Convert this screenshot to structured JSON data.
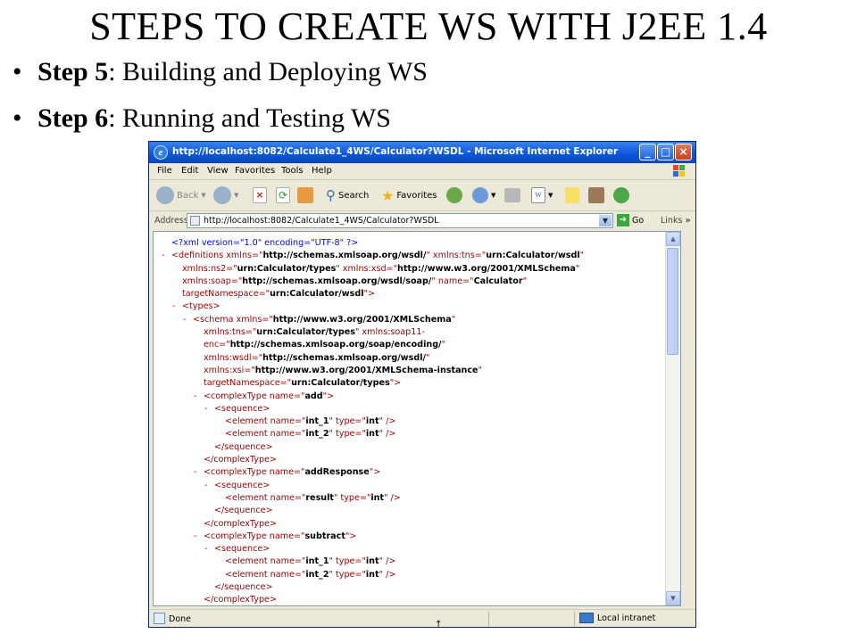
{
  "slide": {
    "title": "STEPS TO CREATE WS WITH J2EE 1.4",
    "bullets": [
      {
        "bold": "Step 5",
        "rest": ": Building and Deploying WS"
      },
      {
        "bold": "Step 6",
        "rest": ": Running and Testing WS"
      }
    ]
  },
  "browser": {
    "window_title": "http://localhost:8082/Calculate1_4WS/Calculator?WSDL - Microsoft Internet Explorer",
    "menu": [
      "File",
      "Edit",
      "View",
      "Favorites",
      "Tools",
      "Help"
    ],
    "toolbar": {
      "back": "Back",
      "search": "Search",
      "favorites": "Favorites"
    },
    "address": {
      "label": "Address",
      "url": "http://localhost:8082/Calculate1_4WS/Calculator?WSDL",
      "go": "Go",
      "links": "Links"
    },
    "status": {
      "text": "Done",
      "zone": "Local intranet"
    },
    "colors": {
      "titlebar": "#0a55d8",
      "chrome": "#ece9d8",
      "markup": "#990000",
      "minus": "#ff0000",
      "pi": "#0000ff"
    }
  },
  "xml": {
    "lines": [
      {
        "indent": 0,
        "minus": false,
        "text": "<?xml version=\"1.0\" encoding=\"UTF-8\" ?>"
      },
      {
        "indent": 0,
        "minus": true,
        "text": "<definitions xmlns=\"http://schemas.xmlsoap.org/wsdl/\" xmlns:tns=\"urn:Calculator/wsdl\""
      },
      {
        "indent": 1,
        "minus": false,
        "text": "xmlns:ns2=\"urn:Calculator/types\" xmlns:xsd=\"http://www.w3.org/2001/XMLSchema\""
      },
      {
        "indent": 1,
        "minus": false,
        "text": "xmlns:soap=\"http://schemas.xmlsoap.org/wsdl/soap/\" name=\"Calculator\""
      },
      {
        "indent": 1,
        "minus": false,
        "text": "targetNamespace=\"urn:Calculator/wsdl\">"
      },
      {
        "indent": 1,
        "minus": true,
        "text": "<types>"
      },
      {
        "indent": 2,
        "minus": true,
        "text": "<schema xmlns=\"http://www.w3.org/2001/XMLSchema\""
      },
      {
        "indent": 3,
        "minus": false,
        "text": "xmlns:tns=\"urn:Calculator/types\" xmlns:soap11-"
      },
      {
        "indent": 3,
        "minus": false,
        "text": "enc=\"http://schemas.xmlsoap.org/soap/encoding/\""
      },
      {
        "indent": 3,
        "minus": false,
        "text": "xmlns:wsdl=\"http://schemas.xmlsoap.org/wsdl/\""
      },
      {
        "indent": 3,
        "minus": false,
        "text": "xmlns:xsi=\"http://www.w3.org/2001/XMLSchema-instance\""
      },
      {
        "indent": 3,
        "minus": false,
        "text": "targetNamespace=\"urn:Calculator/types\">"
      },
      {
        "indent": 3,
        "minus": true,
        "text": "<complexType name=\"add\">"
      },
      {
        "indent": 4,
        "minus": true,
        "text": "<sequence>"
      },
      {
        "indent": 5,
        "minus": false,
        "text": "<element name=\"int_1\" type=\"int\" />"
      },
      {
        "indent": 5,
        "minus": false,
        "text": "<element name=\"int_2\" type=\"int\" />"
      },
      {
        "indent": 4,
        "minus": false,
        "text": "</sequence>"
      },
      {
        "indent": 3,
        "minus": false,
        "text": "</complexType>"
      },
      {
        "indent": 3,
        "minus": true,
        "text": "<complexType name=\"addResponse\">"
      },
      {
        "indent": 4,
        "minus": true,
        "text": "<sequence>"
      },
      {
        "indent": 5,
        "minus": false,
        "text": "<element name=\"result\" type=\"int\" />"
      },
      {
        "indent": 4,
        "minus": false,
        "text": "</sequence>"
      },
      {
        "indent": 3,
        "minus": false,
        "text": "</complexType>"
      },
      {
        "indent": 3,
        "minus": true,
        "text": "<complexType name=\"subtract\">"
      },
      {
        "indent": 4,
        "minus": true,
        "text": "<sequence>"
      },
      {
        "indent": 5,
        "minus": false,
        "text": "<element name=\"int_1\" type=\"int\" />"
      },
      {
        "indent": 5,
        "minus": false,
        "text": "<element name=\"int_2\" type=\"int\" />"
      },
      {
        "indent": 4,
        "minus": false,
        "text": "</sequence>"
      },
      {
        "indent": 3,
        "minus": false,
        "text": "</complexType>"
      }
    ]
  }
}
